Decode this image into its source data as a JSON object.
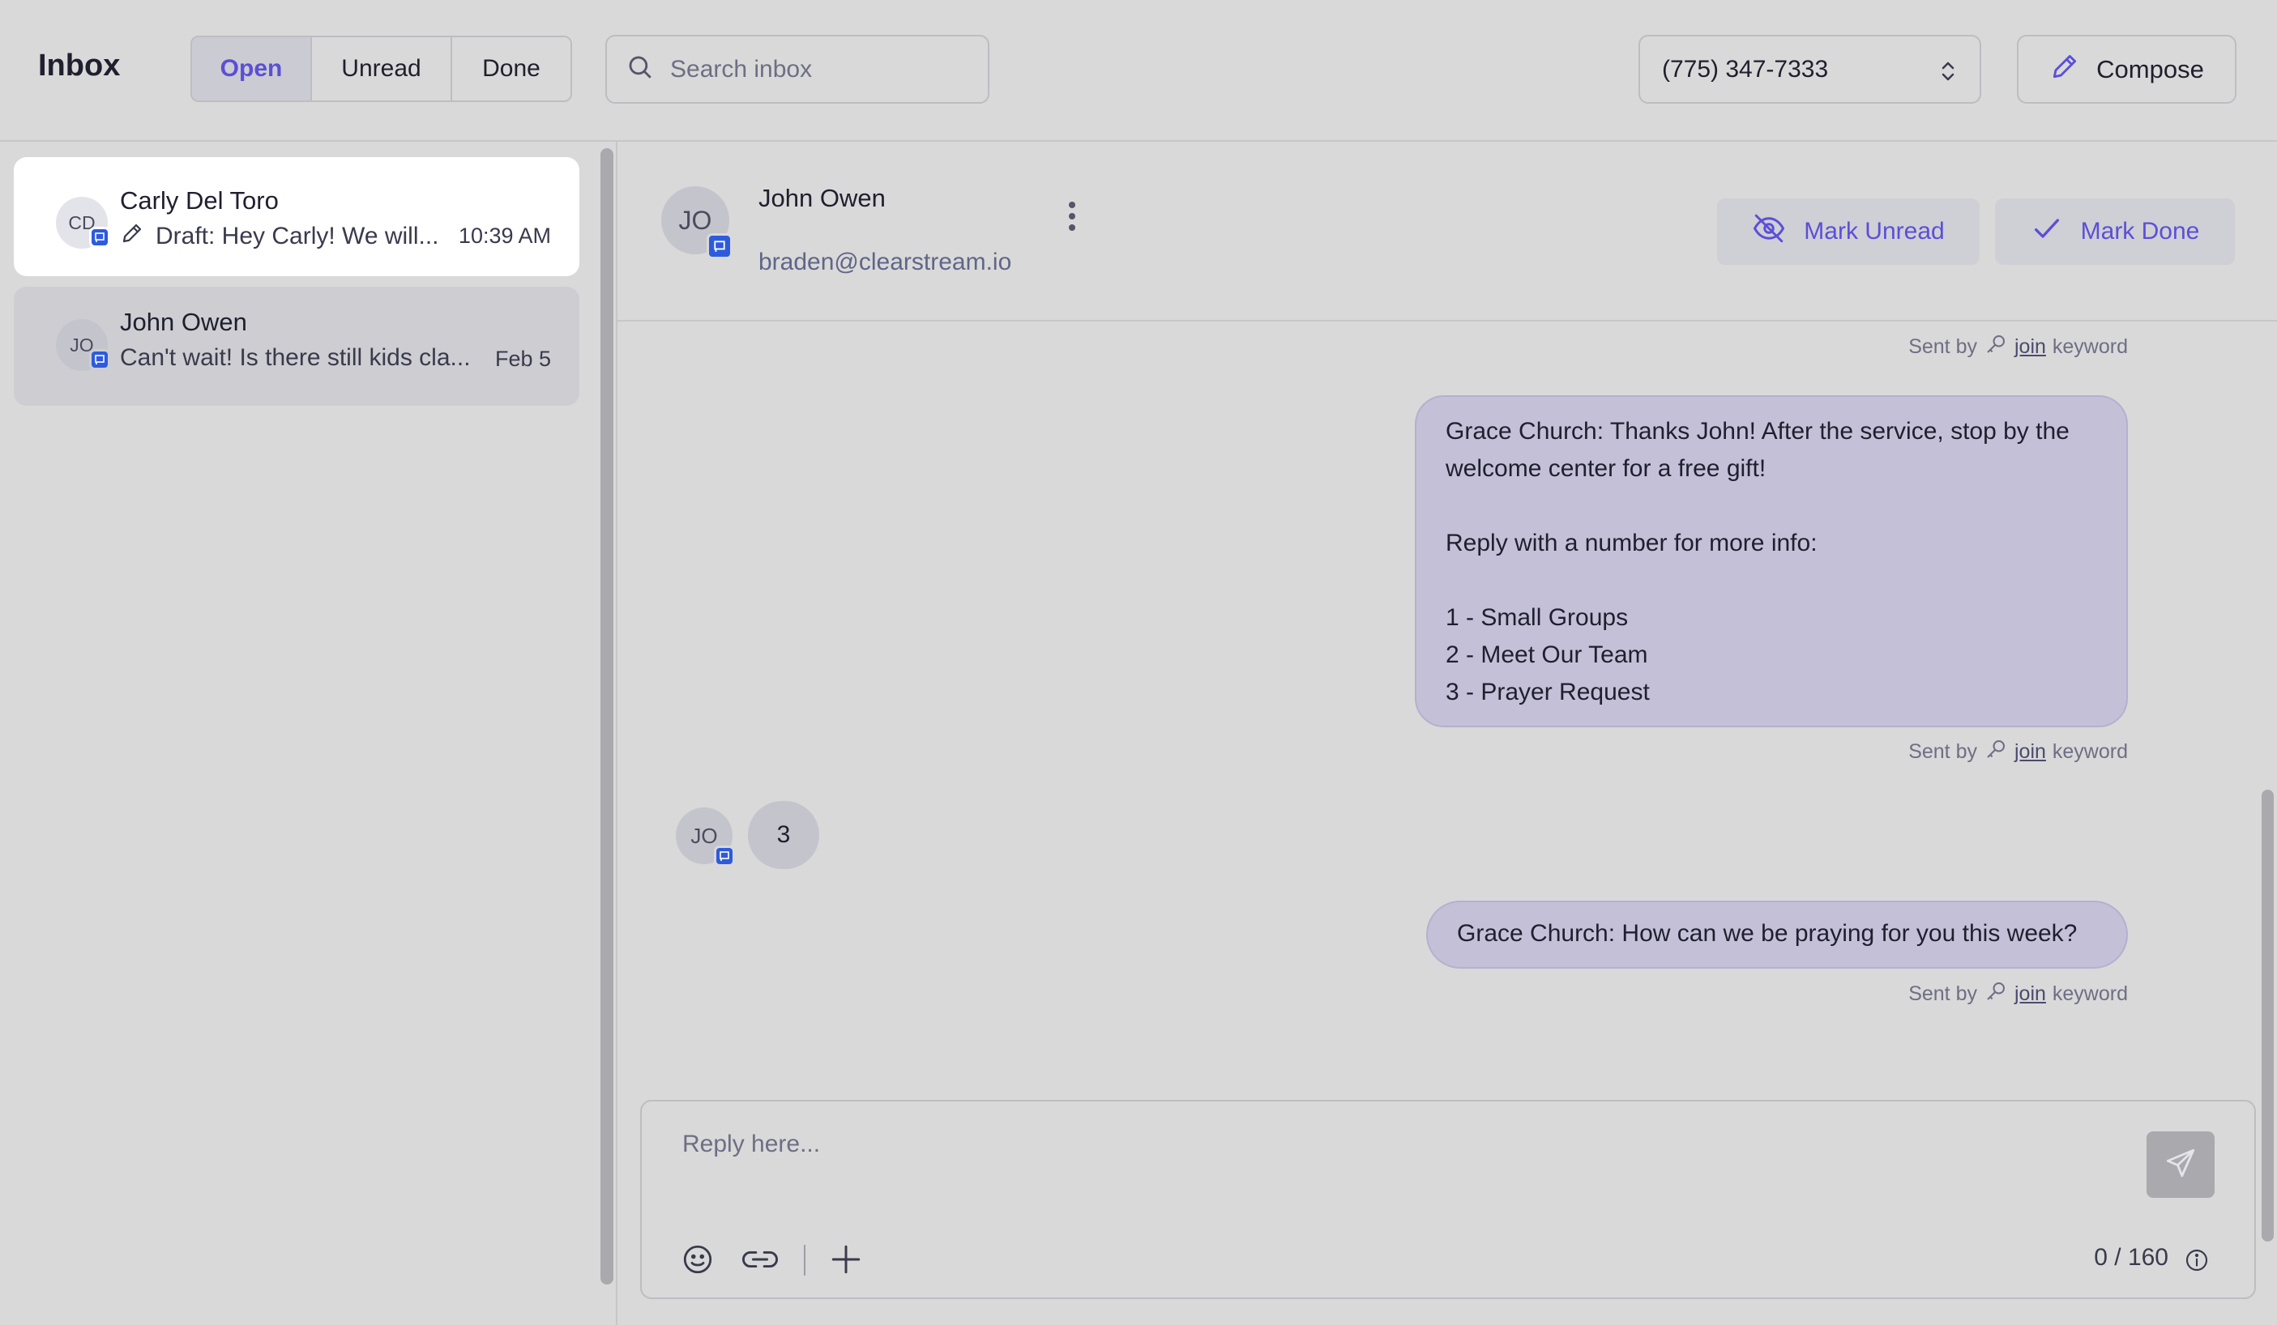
{
  "header": {
    "title": "Inbox",
    "filters": [
      {
        "label": "Open",
        "active": true
      },
      {
        "label": "Unread",
        "active": false
      },
      {
        "label": "Done",
        "active": false
      }
    ],
    "search_placeholder": "Search inbox",
    "phone_number": "(775) 347-7333",
    "compose_label": "Compose"
  },
  "conversations": [
    {
      "initials": "CD",
      "name": "Carly Del Toro",
      "preview": "Draft: Hey Carly! We will...",
      "time": "10:39 AM",
      "draft": true
    },
    {
      "initials": "JO",
      "name": "John Owen",
      "preview": "Can't wait! Is there still kids cla...",
      "time": "Feb 5",
      "draft": false
    }
  ],
  "contact": {
    "initials": "JO",
    "name": "John Owen",
    "email": "braden@clearstream.io",
    "mark_unread_label": "Mark Unread",
    "mark_done_label": "Mark Done"
  },
  "sent_by": {
    "prefix": "Sent by",
    "keyword": "join",
    "suffix": "keyword"
  },
  "messages": [
    {
      "direction": "outgoing",
      "text": "Grace Church: Thanks John! After the service, stop by the welcome center for a free gift!\n\nReply with a number for more info:\n\n1 - Small Groups\n2 - Meet Our Team\n3 - Prayer Request"
    },
    {
      "direction": "incoming",
      "initials": "JO",
      "text": "3"
    },
    {
      "direction": "outgoing",
      "text": "Grace Church: How can we be praying for you this week?"
    }
  ],
  "composer": {
    "placeholder": "Reply here...",
    "char_count": "0 / 160"
  },
  "colors": {
    "accent": "#5b4fd6",
    "badge": "#2e5bdc",
    "outgoing_bubble": "#c4c0d8"
  }
}
